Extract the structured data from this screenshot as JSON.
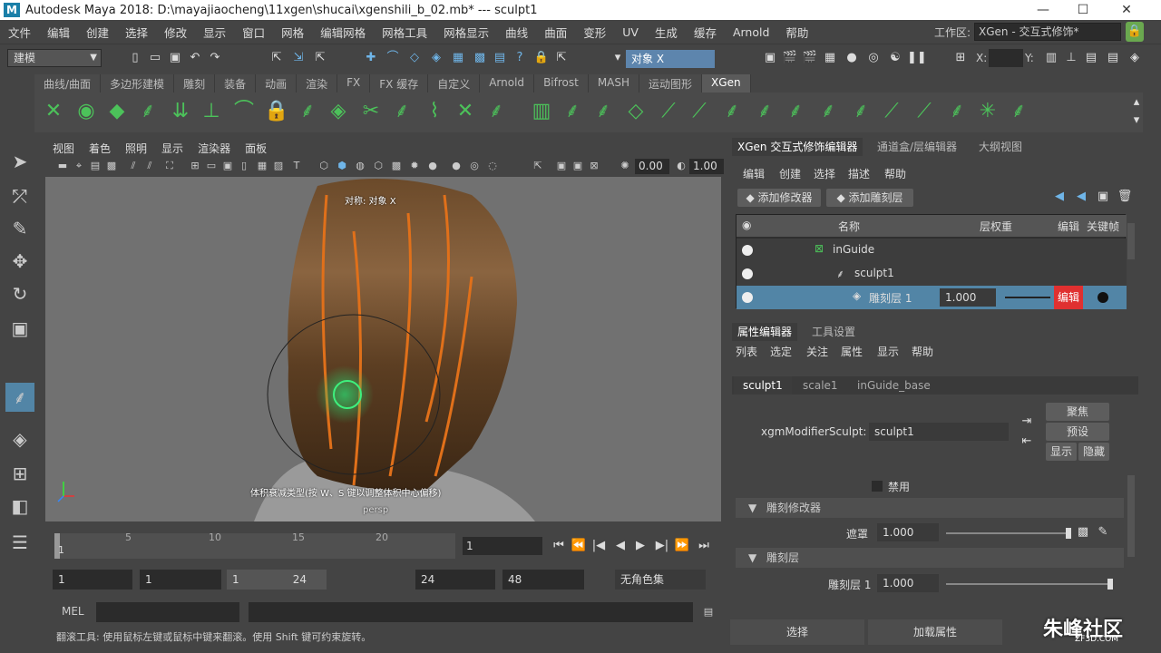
{
  "window": {
    "title": "Autodesk Maya 2018: D:\\mayajiaocheng\\11xgen\\shucai\\xgenshili_b_02.mb*   ---   sculpt1",
    "logo": "M",
    "minimize": "—",
    "maximize": "☐",
    "close": "✕"
  },
  "menubar": {
    "items": [
      "文件",
      "编辑",
      "创建",
      "选择",
      "修改",
      "显示",
      "窗口",
      "网格",
      "编辑网格",
      "网格工具",
      "网格显示",
      "曲线",
      "曲面",
      "变形",
      "UV",
      "生成",
      "缓存",
      "Arnold",
      "帮助"
    ],
    "workspace_label": "工作区:",
    "workspace_value": "XGen - 交互式修饰*"
  },
  "statusline": {
    "mode": "建模",
    "object_field": "对象 X",
    "x_label": "X:",
    "y_label": "Y:"
  },
  "shelf": {
    "tabs": [
      "曲线/曲面",
      "多边形建模",
      "雕刻",
      "装备",
      "动画",
      "渲染",
      "FX",
      "FX 缓存",
      "自定义",
      "Arnold",
      "Bifrost",
      "MASH",
      "运动图形",
      "XGen"
    ],
    "active_tab": "XGen"
  },
  "viewport": {
    "menu": [
      "视图",
      "着色",
      "照明",
      "显示",
      "渲染器",
      "面板"
    ],
    "field1": "0.00",
    "field2": "1.00",
    "top_label": "对称: 对象 X",
    "bottom_label": "体积衰减类型(按 W、S 键以调整体积中心偏移)",
    "camera": "persp"
  },
  "timeline": {
    "ticks": [
      "5",
      "10",
      "15",
      "20"
    ],
    "start_frame": "1",
    "current_frame": "1"
  },
  "range": {
    "start": "1",
    "inner_start": "1",
    "range_start": "1",
    "range_end": "24",
    "end": "24",
    "anim_end": "48",
    "char_set": "无角色集"
  },
  "mel": {
    "label": "MEL"
  },
  "help_line": "翻滚工具: 使用鼠标左键或鼠标中键来翻滚。使用 Shift 键可约束旋转。",
  "right_panel": {
    "tabs": [
      "XGen 交互式修饰编辑器",
      "通道盒/层编辑器",
      "大纲视图"
    ],
    "menu": [
      "编辑",
      "创建",
      "选择",
      "描述",
      "帮助"
    ],
    "add_modifier": "添加修改器",
    "add_sculpt_layer": "添加雕刻层",
    "table_headers": {
      "name": "名称",
      "weight": "层权重",
      "edit": "编辑",
      "keyframe": "关键帧"
    },
    "rows": [
      {
        "name": "inGuide"
      },
      {
        "name": "sculpt1"
      },
      {
        "name": "雕刻层 1",
        "weight": "1.000",
        "edit": "编辑"
      }
    ],
    "attr_tabs": [
      "属性编辑器",
      "工具设置"
    ],
    "attr_menu": [
      "列表",
      "选定",
      "关注",
      "属性",
      "显示",
      "帮助"
    ],
    "node_tabs": [
      "sculpt1",
      "scale1",
      "inGuide_base"
    ],
    "xgm_label": "xgmModifierSculpt:",
    "xgm_value": "sculpt1",
    "focus_btn": "聚焦",
    "preset_btn": "预设",
    "show_btn": "显示",
    "hide_btn": "隐藏",
    "disable_label": "禁用",
    "section1": "雕刻修改器",
    "mask_label": "遮罩",
    "mask_value": "1.000",
    "section2": "雕刻层",
    "layer_label": "雕刻层 1",
    "layer_value": "1.000",
    "bottom_select": "选择",
    "bottom_load": "加载属性"
  },
  "watermark": {
    "text": "朱峰社区",
    "sub": "ZF3D.COM"
  }
}
